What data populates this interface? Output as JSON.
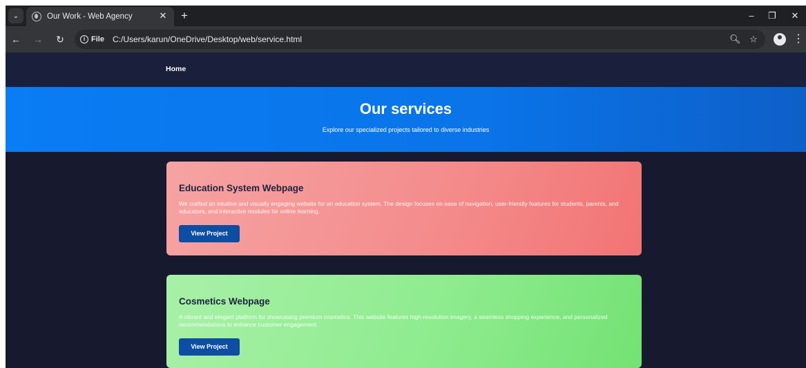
{
  "browser": {
    "tab_title": "Our Work - Web Agency",
    "site_chip_label": "File",
    "url": "C:/Users/karun/OneDrive/Desktop/web/service.html"
  },
  "site": {
    "nav": {
      "home_label": "Home"
    },
    "hero": {
      "title": "Our services",
      "subtitle": "Explore our specialized projects tailored to diverse industries"
    },
    "cards": [
      {
        "title": "Education System Webpage",
        "description": "We crafted an intuitive and visually engaging website for an education system. The design focuses on ease of navigation, user-friendly features for students, parents, and educators, and interactive modules for online learning.",
        "button_label": "View Project",
        "color": "#f48d8d"
      },
      {
        "title": "Cosmetics Webpage",
        "description": "A vibrant and elegant platform for showcasing premium cosmetics. This website features high-resolution imagery, a seamless shopping experience, and personalized recommendations to enhance customer engagement.",
        "button_label": "View Project",
        "color": "#8fec8f"
      }
    ]
  },
  "icons": {
    "tab_favicon": "globe-icon",
    "back": "arrow-left-icon",
    "forward": "arrow-right-icon",
    "reload": "reload-icon",
    "info": "info-icon",
    "zoom": "zoom-icon",
    "bookmark": "star-icon",
    "profile": "profile-icon",
    "menu": "kebab-menu-icon"
  },
  "colors": {
    "hero_blue": "#0a7cf4",
    "page_bg": "#171a2e",
    "button_blue": "#0d4da3"
  }
}
